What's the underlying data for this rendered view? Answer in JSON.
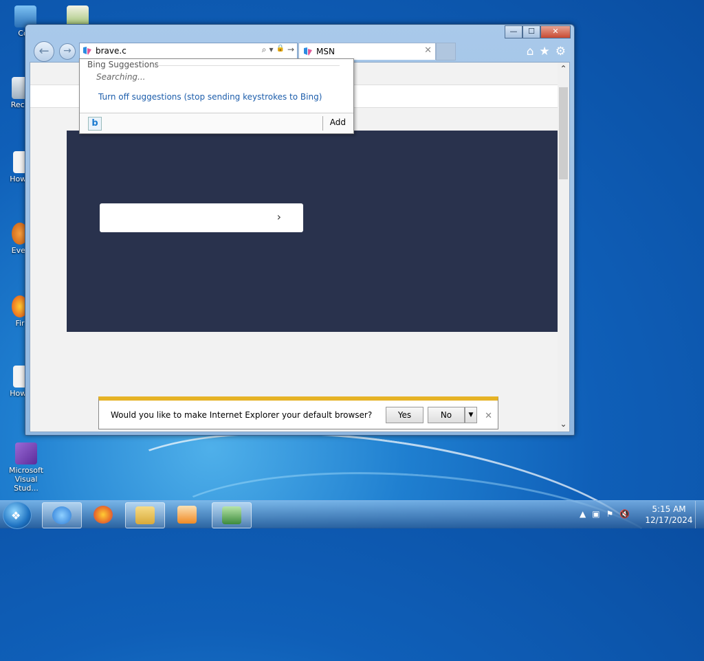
{
  "desktop": {
    "icons": [
      {
        "label": "Con"
      },
      {
        "label": ""
      },
      {
        "label": "Recy"
      },
      {
        "label": "How_"
      },
      {
        "label": "Ever"
      },
      {
        "label": "Fir"
      },
      {
        "label": "How_"
      },
      {
        "label": "Microsoft Visual Stud..."
      }
    ]
  },
  "window": {
    "controls": {
      "minimize": "—",
      "maximize": "☐",
      "close": "✕"
    }
  },
  "nav": {
    "back": "←",
    "forward": "→"
  },
  "address_bar": {
    "value": "brave.c",
    "search_icon": "⌕",
    "dropdown_icon": "▾",
    "lock_icon": "🔒",
    "go_icon": "→"
  },
  "tabs": [
    {
      "label": "MSN",
      "close": "✕"
    }
  ],
  "toolbar_icons": {
    "home": "⌂",
    "favorites": "★",
    "tools": "⚙"
  },
  "suggestions": {
    "header": "Bing Suggestions",
    "status": "Searching...",
    "turn_off": "Turn off suggestions (stop sending keystrokes to Bing)",
    "provider_letter": "b",
    "add": "Add"
  },
  "page": {
    "hero_chevron": "›"
  },
  "notification": {
    "message": "Would you like to make Internet Explorer your default browser?",
    "yes": "Yes",
    "no": "No",
    "dropdown": "▼",
    "close": "✕"
  },
  "scrollbar": {
    "up": "⌃",
    "down": "⌄"
  },
  "taskbar": {
    "apps": [
      {
        "name": "internet-explorer",
        "color": "#2a7ad6"
      },
      {
        "name": "firefox",
        "color": "#e8702a"
      },
      {
        "name": "file-explorer",
        "color": "#e8c45a"
      },
      {
        "name": "media-player",
        "color": "#f08a24"
      },
      {
        "name": "remote-desktop",
        "color": "#3d8b3d"
      }
    ],
    "clock_time": "5:15 AM",
    "clock_date": "12/17/2024"
  },
  "colors": {
    "hero_background": "#29324d",
    "notification_accent": "#e6b325",
    "link": "#1c5dab"
  }
}
